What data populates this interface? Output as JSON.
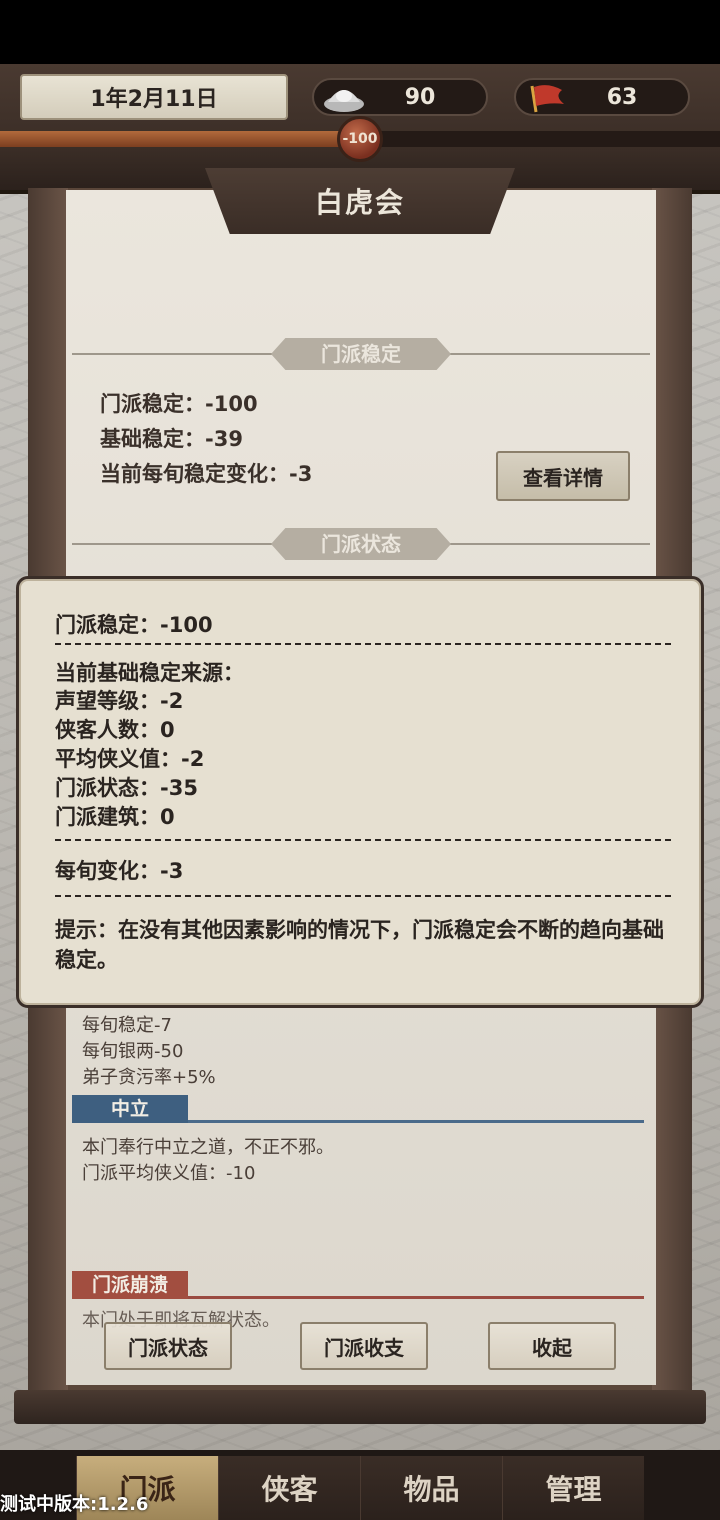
{
  "hud": {
    "date": "1年2月11日",
    "silver": "90",
    "flag_count": "63",
    "stability_knob": "-100",
    "silver_icon": "silver-ingot-icon",
    "flag_icon": "red-flag-icon"
  },
  "panel": {
    "title": "白虎会",
    "section_stability": "门派稳定",
    "stability": "门派稳定：-100",
    "base_stability": "基础稳定：-39",
    "change_per_period": "当前每旬稳定变化：-3",
    "detail_button": "查看详情",
    "section_status": "门派状态"
  },
  "lower": {
    "line1": "每旬稳定-7",
    "line2": "每旬银两-50",
    "line3": "弟子贪污率+5%",
    "neutral_tag": "中立",
    "neutral_desc": "本门奉行中立之道，不正不邪。",
    "neutral_avg": "门派平均侠义值：-10",
    "collapse_tag": "门派崩溃",
    "collapse_desc": "本门处于即将瓦解状态。"
  },
  "tooltip": {
    "stability": "门派稳定：-100",
    "sources_title": "当前基础稳定来源：",
    "reputation": "声望等级：-2",
    "member_count": "侠客人数：0",
    "avg_chivalry": "平均侠义值：-2",
    "sect_status": "门派状态：-35",
    "buildings": "门派建筑：0",
    "per_period_change": "每旬变化：-3",
    "hint": "提示：在没有其他因素影响的情况下，门派稳定会不断的趋向基础稳定。"
  },
  "buttons": {
    "sect_status": "门派状态",
    "sect_finance": "门派收支",
    "collapse": "收起"
  },
  "nav": {
    "tabs": [
      "门派",
      "侠客",
      "物品",
      "管理"
    ],
    "active": "门派"
  },
  "version": "测试中版本:1.2.6"
}
